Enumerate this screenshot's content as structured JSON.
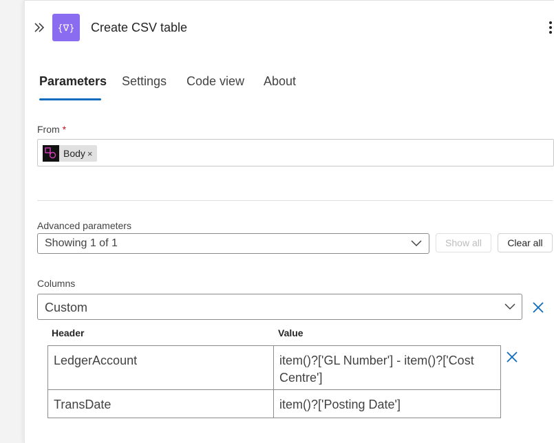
{
  "header": {
    "title": "Create CSV table",
    "app_icon_glyph": "{∇}",
    "accent_color": "#8a6cf0"
  },
  "tabs": [
    {
      "label": "Parameters",
      "active": true
    },
    {
      "label": "Settings",
      "active": false
    },
    {
      "label": "Code view",
      "active": false
    },
    {
      "label": "About",
      "active": false
    }
  ],
  "from": {
    "label": "From",
    "required_mark": "*",
    "token_label": "Body",
    "token_remove": "×"
  },
  "advanced": {
    "label": "Advanced parameters",
    "value": "Showing 1 of 1",
    "show_all_label": "Show all",
    "clear_all_label": "Clear all"
  },
  "columns": {
    "label": "Columns",
    "value": "Custom",
    "header_col": "Header",
    "value_col": "Value",
    "rows": [
      {
        "header": "LedgerAccount",
        "value": "item()?['GL Number'] - item()?['Cost Centre']"
      },
      {
        "header": "TransDate",
        "value": "item()?['Posting Date']"
      }
    ]
  },
  "colors": {
    "primary": "#0f6cbd",
    "required": "#c50f1f"
  }
}
